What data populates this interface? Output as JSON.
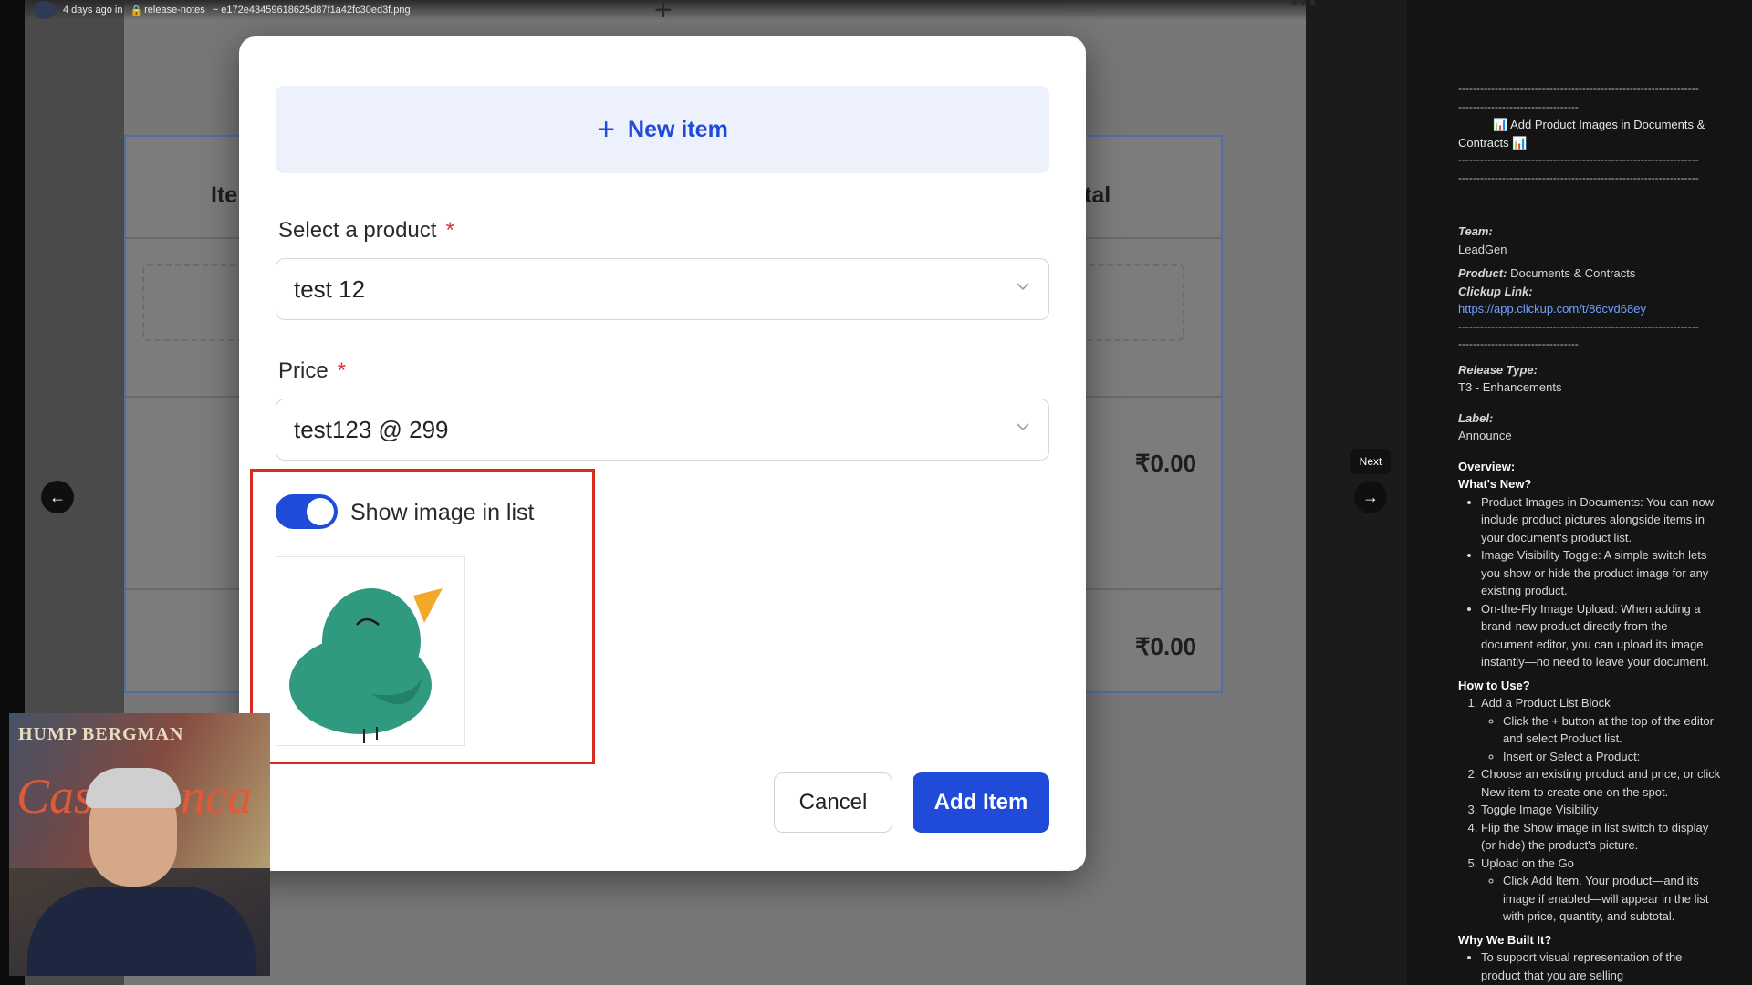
{
  "viewer": {
    "topbar_meta": "4 days ago in",
    "topbar_channel": "release-notes",
    "topbar_file": "~ e172e43459618625d87f1a42fc30ed3f.png",
    "next_tooltip": "Next",
    "prev_icon": "arrow-left-icon",
    "next_icon": "arrow-right-icon"
  },
  "background_doc": {
    "header_left_partial": "Ite",
    "header_right_partial": "tal",
    "amount_1": "₹0.00",
    "amount_2": "₹0.00"
  },
  "modal": {
    "new_item_label": "New item",
    "product_label": "Select a product",
    "product_required": "*",
    "product_value": "test 12",
    "price_label": "Price",
    "price_required": "*",
    "price_value": "test123 @ 299",
    "toggle_label": "Show image in list",
    "toggle_on": true,
    "cancel_label": "Cancel",
    "add_label": "Add Item",
    "accent_color": "#1f4bd8",
    "highlight_color": "#d92a22"
  },
  "webcam": {
    "poster_text_top": "HUMP BERGMAN",
    "poster_text_script": "Casablanca"
  },
  "notes": {
    "title_line1": "Add Product Images in Documents &",
    "title_line2": "Contracts",
    "team_key": "Team:",
    "team_value": "LeadGen",
    "product_key": "Product:",
    "product_value": "Documents & Contracts",
    "clickup_key": "Clickup Link:",
    "clickup_value": "https://app.clickup.com/t/86cvd68ey",
    "release_type_key": "Release Type:",
    "release_type_value": "T3 - Enhancements",
    "label_key": "Label:",
    "label_value": "Announce",
    "overview": "Overview:",
    "whats_new": "What's New?",
    "whats_new_items": [
      "Product Images in Documents: You can now include product pictures alongside items in your document's product list.",
      "Image Visibility Toggle: A simple switch lets you show or hide the product image for any existing product.",
      "On-the-Fly Image Upload: When adding a brand-new product directly from the document editor, you can upload its image instantly—no need to leave your document."
    ],
    "how_to_use": "How to Use?",
    "step_1": "Add a Product List Block",
    "step_1_sub_1": "Click the + button at the top of the editor and select Product list.",
    "step_1_sub_2": "Insert or Select a Product:",
    "step_2": "Choose an existing product and price, or click New item to create one on the spot.",
    "step_3": "Toggle Image Visibility",
    "step_4": "Flip the Show image in list switch to display (or hide) the product's picture.",
    "step_5": "Upload on the Go",
    "step_5_sub_1": "Click Add Item. Your product—and its image if enabled—will appear in the list with price, quantity, and subtotal.",
    "why_built": "Why We Built It?",
    "why_item_1": "To support visual representation of the product that you are selling"
  }
}
